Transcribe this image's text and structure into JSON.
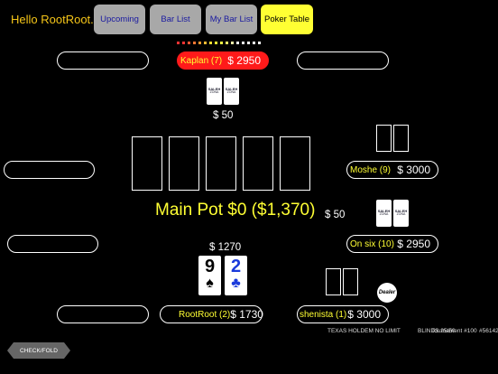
{
  "greeting": "Hello RootRoot.",
  "nav": {
    "tabs": [
      {
        "label": "Upcoming",
        "active": false
      },
      {
        "label": "Bar List",
        "active": false
      },
      {
        "label": "My Bar List",
        "active": false
      },
      {
        "label": "Poker Table",
        "active": true
      }
    ]
  },
  "players": {
    "top": {
      "name": "Kaplan (7)",
      "stack": "$ 2950",
      "bet": "$ 50"
    },
    "right_upper": {
      "name": "Moshe (9)",
      "stack": "$ 3000"
    },
    "right_lower": {
      "name": "On six (10)",
      "stack": "$ 2950",
      "bet": "$ 50"
    },
    "bottom_right": {
      "name": "shenista (1)",
      "stack": "$ 3000"
    },
    "hero": {
      "name": "RootRoot (2)",
      "stack": "$ 1730",
      "bet": "$ 1270",
      "cards": [
        {
          "rank": "9",
          "suit": "♠",
          "color": "#000"
        },
        {
          "rank": "2",
          "suit": "♣",
          "color": "#1a3adb"
        }
      ]
    }
  },
  "card_back_text": {
    "line1": "SALEH",
    "line2": "ZONA"
  },
  "pot": "Main Pot $0 ($1,370)",
  "dealer_label": "Dealer",
  "footer": {
    "game": "TEXAS HOLDEM NO LIMIT",
    "blinds": "BLINDS 25/50",
    "tournament": "Tournament #100",
    "hand": "#56142"
  },
  "actions": {
    "check_fold": "CHECK/FOLD"
  },
  "colors": {
    "accent": "#ffff33",
    "active_seat": "#ff1a1a",
    "greeting": "#f5c518"
  }
}
